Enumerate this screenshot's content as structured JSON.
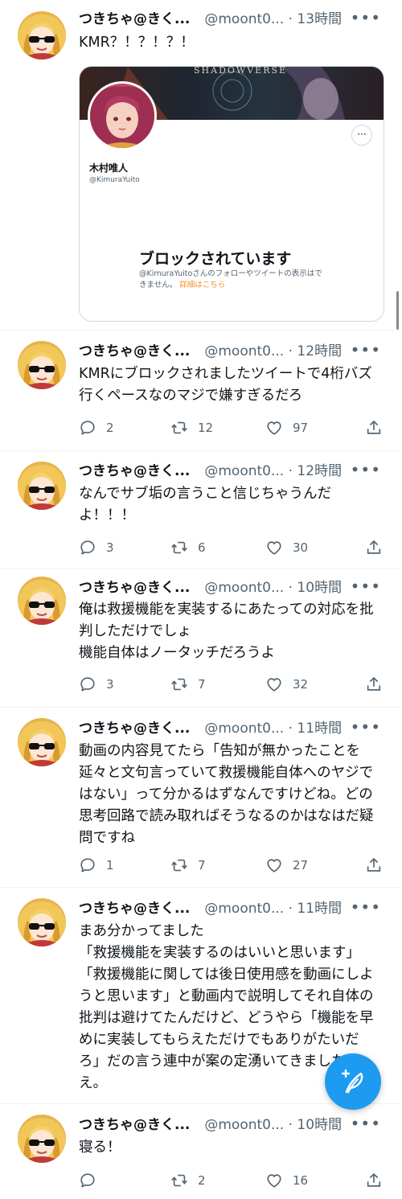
{
  "colors": {
    "accent": "#1d9bf0",
    "muted": "#536471",
    "link_orange": "#f4901e"
  },
  "tweets": [
    {
      "name": "つきちゃ@きく...",
      "handle": "@moont0...",
      "time": "· 13時間",
      "text": "KMR？！？！？！",
      "embed": {
        "banner_text": "SHADOWVERSE",
        "name": "木村唯人",
        "handle": "@KimuraYuito",
        "more": "···",
        "title": "ブロックされています",
        "desc": "@KimuraYuitoさんのフォローやツイートの表示はできません。",
        "link": "詳細はこちら"
      }
    },
    {
      "name": "つきちゃ@きく...",
      "handle": "@moont0...",
      "time": "· 12時間",
      "text": "KMRにブロックされましたツイートで4桁バズ\n行くペースなのマジで嫌すぎるだろ",
      "replies": "2",
      "retweets": "12",
      "likes": "97"
    },
    {
      "name": "つきちゃ@きく...",
      "handle": "@moont0...",
      "time": "· 12時間",
      "text": "なんでサブ垢の言うこと信じちゃうんだ\nよ！！！",
      "replies": "3",
      "retweets": "6",
      "likes": "30"
    },
    {
      "name": "つきちゃ@きく...",
      "handle": "@moont0...",
      "time": "· 10時間",
      "text": "俺は救援機能を実装するにあたっての対応を批\n判しただけでしょ\n機能自体はノータッチだろうよ",
      "replies": "3",
      "retweets": "7",
      "likes": "32"
    },
    {
      "name": "つきちゃ@きく...",
      "handle": "@moont0...",
      "time": "· 11時間",
      "text": "動画の内容見てたら「告知が無かったことを\n延々と文句言っていて救援機能自体へのヤジで\nはない」って分かるはずなんですけどね。どの\n思考回路で読み取ればそうなるのかはなはだ疑\n問ですね",
      "replies": "1",
      "retweets": "7",
      "likes": "27"
    },
    {
      "name": "つきちゃ@きく...",
      "handle": "@moont0...",
      "time": "· 11時間",
      "text": "まあ分かってました\n「救援機能を実装するのはいいと思います」\n「救援機能に関しては後日使用感を動画にしよ\nうと思います」と動画内で説明してそれ自体の\n批判は避けてたんだけど、どうやら「機能を早\nめに実装してもらえただけでもありがたいだ\nろ」だの言う連中が案の定湧いてきましたね\nえ。"
    },
    {
      "name": "つきちゃ@きく...",
      "handle": "@moont0...",
      "time": "· 10時間",
      "text": "寝る！",
      "replies": "",
      "retweets": "2",
      "likes": "16"
    }
  ]
}
